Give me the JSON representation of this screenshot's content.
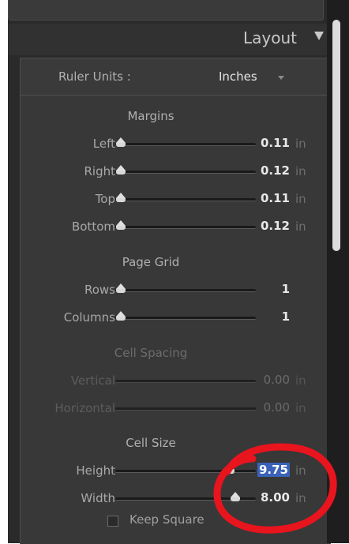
{
  "panel": {
    "title": "Layout"
  },
  "ruler_units": {
    "label": "Ruler Units :",
    "value": "Inches"
  },
  "margins": {
    "title": "Margins",
    "rows": [
      {
        "label": "Left",
        "value": "0.11",
        "unit": "in",
        "position": 0.02
      },
      {
        "label": "Right",
        "value": "0.12",
        "unit": "in",
        "position": 0.02
      },
      {
        "label": "Top",
        "value": "0.11",
        "unit": "in",
        "position": 0.02
      },
      {
        "label": "Bottom",
        "value": "0.12",
        "unit": "in",
        "position": 0.02
      }
    ]
  },
  "page_grid": {
    "title": "Page Grid",
    "rows": [
      {
        "label": "Rows",
        "value": "1",
        "position": 0.0
      },
      {
        "label": "Columns",
        "value": "1",
        "position": 0.0
      }
    ]
  },
  "cell_spacing": {
    "title": "Cell Spacing",
    "rows": [
      {
        "label": "Vertical",
        "value": "0.00",
        "unit": "in"
      },
      {
        "label": "Horizontal",
        "value": "0.00",
        "unit": "in"
      }
    ]
  },
  "cell_size": {
    "title": "Cell Size",
    "rows": [
      {
        "label": "Height",
        "value": "9.75",
        "unit": "in",
        "position": 0.82
      },
      {
        "label": "Width",
        "value": "8.00",
        "unit": "in",
        "position": 0.86
      }
    ],
    "keep_square": {
      "label": "Keep Square",
      "checked": false
    }
  },
  "colors": {
    "accent_selection": "#3a62b8",
    "annotation": "#e8141e"
  }
}
